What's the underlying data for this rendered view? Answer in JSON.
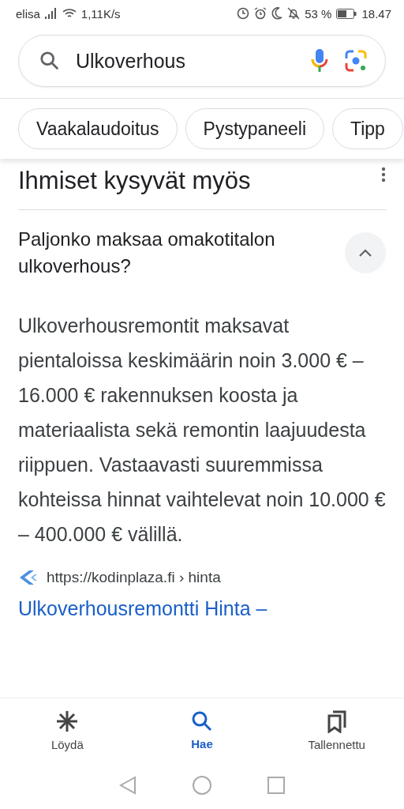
{
  "status_bar": {
    "carrier": "elisa",
    "speed": "1,11K/s",
    "battery": "53 %",
    "time": "18.47"
  },
  "search": {
    "value": "Ulkoverhous"
  },
  "chips": [
    {
      "label": "Vaakalaudoitus"
    },
    {
      "label": "Pystypaneeli"
    },
    {
      "label": "Tipp"
    }
  ],
  "section": {
    "title": "Ihmiset kysyvät myös",
    "question": {
      "text": "Paljonko maksaa omakotitalon ulkoverhous?",
      "expanded": true
    },
    "answer": "Ulkoverhousremontit maksavat pientaloissa keskimäärin noin 3.000 € – 16.000 € rakennuksen koosta ja materiaalista sekä remontin laajuudesta riippuen. Vastaavasti suuremmissa kohteissa hinnat vaihtelevat noin 10.000 € – 400.000 € välillä.",
    "source": {
      "url": "https://kodinplaza.fi › hinta",
      "title": "Ulkoverhousremontti Hinta –"
    }
  },
  "bottom_nav": [
    {
      "kind": "discover",
      "label": "Löydä",
      "selected": false
    },
    {
      "kind": "search",
      "label": "Hae",
      "selected": true
    },
    {
      "kind": "saved",
      "label": "Tallennettu",
      "selected": false
    }
  ]
}
